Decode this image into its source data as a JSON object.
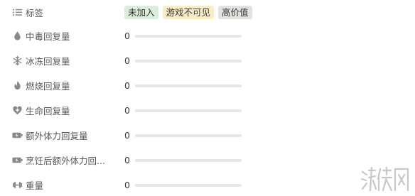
{
  "tags_row": {
    "label": "标签",
    "icon": "list-icon",
    "tags": [
      {
        "text": "未加入",
        "color": "#dbeddb"
      },
      {
        "text": "游戏不可见",
        "color": "#fbecc8"
      },
      {
        "text": "高价值",
        "color": "#e3e2e0"
      }
    ]
  },
  "properties": [
    {
      "label": "中毒回复量",
      "icon": "drop-icon",
      "value": "0",
      "progress": 0
    },
    {
      "label": "冰冻回复量",
      "icon": "snowflake-icon",
      "value": "0",
      "progress": 0
    },
    {
      "label": "燃烧回复量",
      "icon": "flame-icon",
      "value": "0",
      "progress": 0
    },
    {
      "label": "生命回复量",
      "icon": "heart-plus-icon",
      "value": "0",
      "progress": 0
    },
    {
      "label": "额外体力回复量",
      "icon": "battery-icon",
      "value": "0",
      "progress": 0
    },
    {
      "label": "烹饪后额外体力回...",
      "icon": "battery-icon",
      "value": "0",
      "progress": 0
    },
    {
      "label": "重量",
      "icon": "dumbbell-icon",
      "value": "0",
      "progress": 0
    }
  ],
  "watermark": {
    "text": "游侠网",
    "icon": "watermark-logo"
  }
}
